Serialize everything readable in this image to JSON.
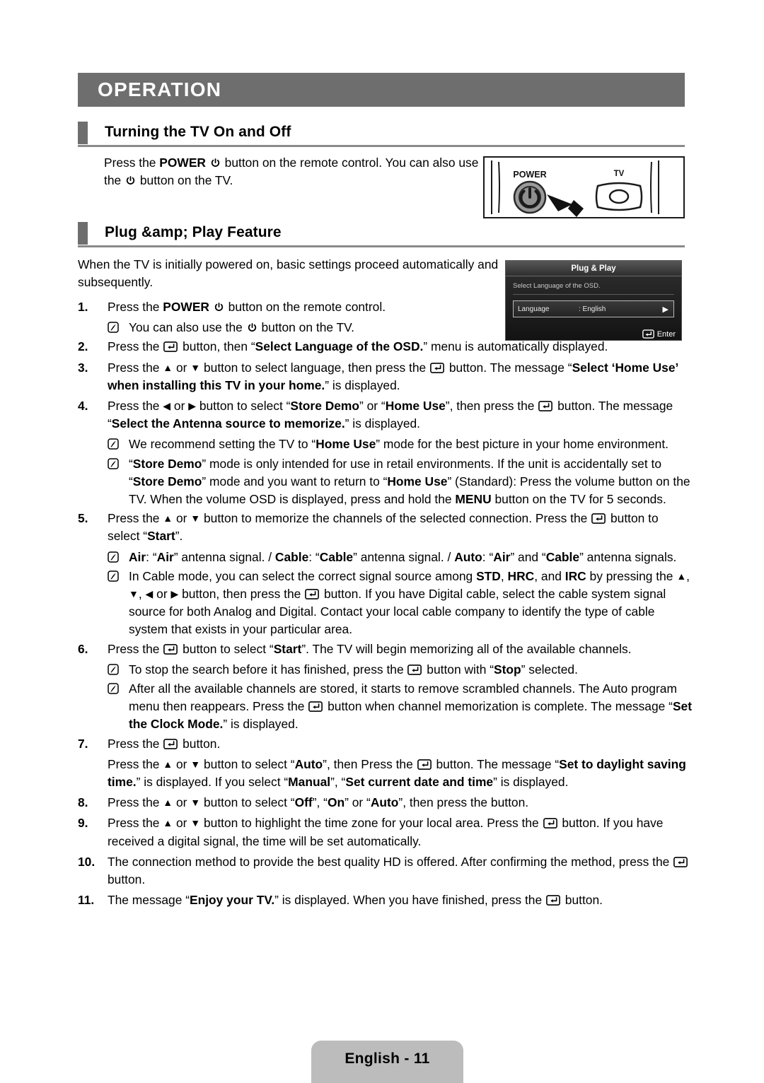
{
  "chapter": {
    "banner_title": "OPERATION"
  },
  "sections": {
    "turning": {
      "heading": "Turning the TV On and Off",
      "intro_html": "Press the <b>POWER</b> [POWER] button on the remote control. You can also use the [POWER] button on the TV."
    },
    "plugplay": {
      "heading": "Plug &amp; Play Feature",
      "intro_html": "When the TV is initially powered on, basic settings proceed automatically and subsequently."
    }
  },
  "steps": [
    {
      "num": "1.",
      "narrow": true,
      "body_html": "Press the <b>POWER</b> [POWER] button on the remote control.",
      "notes": [
        {
          "narrow": true,
          "body_html": "You can also use the [POWER] button on the TV."
        }
      ]
    },
    {
      "num": "2.",
      "narrow": true,
      "body_html": "Press the [ENTER] button, then &ldquo;<b>Select Language of the OSD.</b>&rdquo; menu is automatically displayed.",
      "notes": []
    },
    {
      "num": "3.",
      "narrow": false,
      "body_html": "Press the [UP] or [DOWN] button to select language, then press the [ENTER] button. The message &ldquo;<b>Select &lsquo;Home Use&rsquo; when installing this TV in your home.</b>&rdquo; is displayed.",
      "notes": []
    },
    {
      "num": "4.",
      "narrow": false,
      "body_html": "Press the [LEFT] or [RIGHT] button to select &ldquo;<b>Store Demo</b>&rdquo; or &ldquo;<b>Home Use</b>&rdquo;, then press the [ENTER] button. The message &ldquo;<b>Select the Antenna source to memorize.</b>&rdquo; is displayed.",
      "notes": [
        {
          "narrow": false,
          "body_html": "We recommend setting the TV to &ldquo;<b>Home Use</b>&rdquo; mode for the best picture in your home environment."
        },
        {
          "narrow": false,
          "body_html": "&ldquo;<b>Store Demo</b>&rdquo; mode is only intended for use in retail environments. If the unit is accidentally set to &ldquo;<b>Store Demo</b>&rdquo; mode and you want to return to &ldquo;<b>Home Use</b>&rdquo; (Standard): Press the volume button on the TV. When the volume OSD is displayed, press and hold the <b>MENU</b> button on the TV for 5 seconds."
        }
      ]
    },
    {
      "num": "5.",
      "narrow": false,
      "body_html": "Press the [UP] or [DOWN] button to memorize the channels of the selected connection. Press the [ENTER] button to select &ldquo;<b>Start</b>&rdquo;.",
      "notes": [
        {
          "narrow": false,
          "body_html": "<b>Air</b>: &ldquo;<b>Air</b>&rdquo; antenna signal. / <b>Cable</b>: &ldquo;<b>Cable</b>&rdquo; antenna signal. / <b>Auto</b>: &ldquo;<b>Air</b>&rdquo; and &ldquo;<b>Cable</b>&rdquo; antenna signals."
        },
        {
          "narrow": false,
          "body_html": "In Cable mode, you can select the correct signal source among <b>STD</b>, <b>HRC</b>, and <b>IRC</b> by pressing the [UP], [DOWN], [LEFT] or [RIGHT] button, then press the [ENTER] button. If you have Digital cable, select the cable system signal source for both Analog and Digital. Contact your local cable company to identify the type of cable system that exists in your particular area."
        }
      ]
    },
    {
      "num": "6.",
      "narrow": false,
      "body_html": "Press the [ENTER] button to select &ldquo;<b>Start</b>&rdquo;. The TV will begin memorizing all of the available channels.",
      "notes": [
        {
          "narrow": false,
          "body_html": "To stop the search before it has finished, press the [ENTER] button with &ldquo;<b>Stop</b>&rdquo; selected."
        },
        {
          "narrow": false,
          "body_html": "After all the available channels are stored, it starts to remove scrambled channels. The Auto program menu then reappears. Press the [ENTER] button when channel memorization is complete. The message &ldquo;<b>Set the Clock Mode.</b>&rdquo; is displayed."
        }
      ]
    },
    {
      "num": "7.",
      "narrow": false,
      "body_html": "Press the [ENTER] button.",
      "notes": []
    },
    {
      "num": "",
      "narrow": false,
      "body_html": "Press the [UP] or [DOWN] button to select &ldquo;<b>Auto</b>&rdquo;, then Press the [ENTER] button. The message &ldquo;<b>Set to daylight saving time.</b>&rdquo; is displayed. If you select &ldquo;<b>Manual</b>&rdquo;, &ldquo;<b>Set current date and time</b>&rdquo; is displayed.",
      "notes": []
    },
    {
      "num": "8.",
      "narrow": false,
      "body_html": "Press the [UP] or [DOWN] button to select &ldquo;<b>Off</b>&rdquo;, &ldquo;<b>On</b>&rdquo; or &ldquo;<b>Auto</b>&rdquo;, then press the  button.",
      "notes": []
    },
    {
      "num": "9.",
      "narrow": false,
      "body_html": "Press the [UP] or [DOWN] button to highlight the time zone for your local area. Press the [ENTER] button. If you have received a digital signal, the time will be set automatically.",
      "notes": []
    },
    {
      "num": "10.",
      "narrow": false,
      "body_html": "The connection method to provide the best quality HD is offered. After confirming the method, press the [ENTER] button.",
      "notes": []
    },
    {
      "num": "11.",
      "narrow": false,
      "body_html": "The message &ldquo;<b>Enjoy your TV.</b>&rdquo; is displayed. When you have finished, press the [ENTER] button.",
      "notes": []
    }
  ],
  "figures": {
    "remote": {
      "power_label": "POWER",
      "tv_label": "TV"
    },
    "osd": {
      "title": "Plug & Play",
      "subtitle": "Select Language of the OSD.",
      "row_label": "Language",
      "row_value": ": English",
      "row_arrow": "▶",
      "footer_text": "Enter"
    }
  },
  "footer": {
    "page_label": "English - 11"
  },
  "colors": {
    "banner_gray": "#6e6e6e",
    "rule_gray": "#8a8a8a",
    "footer_gray": "#bcbcbc",
    "osd_dark": "#1b1b1b"
  }
}
